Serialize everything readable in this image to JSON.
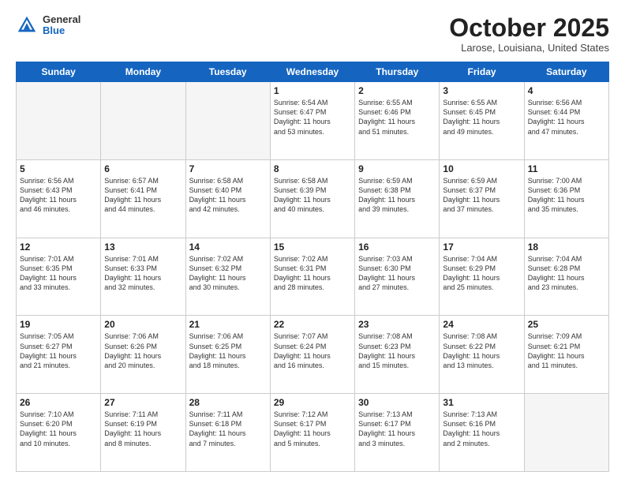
{
  "header": {
    "logo_general": "General",
    "logo_blue": "Blue",
    "month": "October 2025",
    "location": "Larose, Louisiana, United States"
  },
  "days_of_week": [
    "Sunday",
    "Monday",
    "Tuesday",
    "Wednesday",
    "Thursday",
    "Friday",
    "Saturday"
  ],
  "weeks": [
    [
      {
        "day": "",
        "info": ""
      },
      {
        "day": "",
        "info": ""
      },
      {
        "day": "",
        "info": ""
      },
      {
        "day": "1",
        "info": "Sunrise: 6:54 AM\nSunset: 6:47 PM\nDaylight: 11 hours\nand 53 minutes."
      },
      {
        "day": "2",
        "info": "Sunrise: 6:55 AM\nSunset: 6:46 PM\nDaylight: 11 hours\nand 51 minutes."
      },
      {
        "day": "3",
        "info": "Sunrise: 6:55 AM\nSunset: 6:45 PM\nDaylight: 11 hours\nand 49 minutes."
      },
      {
        "day": "4",
        "info": "Sunrise: 6:56 AM\nSunset: 6:44 PM\nDaylight: 11 hours\nand 47 minutes."
      }
    ],
    [
      {
        "day": "5",
        "info": "Sunrise: 6:56 AM\nSunset: 6:43 PM\nDaylight: 11 hours\nand 46 minutes."
      },
      {
        "day": "6",
        "info": "Sunrise: 6:57 AM\nSunset: 6:41 PM\nDaylight: 11 hours\nand 44 minutes."
      },
      {
        "day": "7",
        "info": "Sunrise: 6:58 AM\nSunset: 6:40 PM\nDaylight: 11 hours\nand 42 minutes."
      },
      {
        "day": "8",
        "info": "Sunrise: 6:58 AM\nSunset: 6:39 PM\nDaylight: 11 hours\nand 40 minutes."
      },
      {
        "day": "9",
        "info": "Sunrise: 6:59 AM\nSunset: 6:38 PM\nDaylight: 11 hours\nand 39 minutes."
      },
      {
        "day": "10",
        "info": "Sunrise: 6:59 AM\nSunset: 6:37 PM\nDaylight: 11 hours\nand 37 minutes."
      },
      {
        "day": "11",
        "info": "Sunrise: 7:00 AM\nSunset: 6:36 PM\nDaylight: 11 hours\nand 35 minutes."
      }
    ],
    [
      {
        "day": "12",
        "info": "Sunrise: 7:01 AM\nSunset: 6:35 PM\nDaylight: 11 hours\nand 33 minutes."
      },
      {
        "day": "13",
        "info": "Sunrise: 7:01 AM\nSunset: 6:33 PM\nDaylight: 11 hours\nand 32 minutes."
      },
      {
        "day": "14",
        "info": "Sunrise: 7:02 AM\nSunset: 6:32 PM\nDaylight: 11 hours\nand 30 minutes."
      },
      {
        "day": "15",
        "info": "Sunrise: 7:02 AM\nSunset: 6:31 PM\nDaylight: 11 hours\nand 28 minutes."
      },
      {
        "day": "16",
        "info": "Sunrise: 7:03 AM\nSunset: 6:30 PM\nDaylight: 11 hours\nand 27 minutes."
      },
      {
        "day": "17",
        "info": "Sunrise: 7:04 AM\nSunset: 6:29 PM\nDaylight: 11 hours\nand 25 minutes."
      },
      {
        "day": "18",
        "info": "Sunrise: 7:04 AM\nSunset: 6:28 PM\nDaylight: 11 hours\nand 23 minutes."
      }
    ],
    [
      {
        "day": "19",
        "info": "Sunrise: 7:05 AM\nSunset: 6:27 PM\nDaylight: 11 hours\nand 21 minutes."
      },
      {
        "day": "20",
        "info": "Sunrise: 7:06 AM\nSunset: 6:26 PM\nDaylight: 11 hours\nand 20 minutes."
      },
      {
        "day": "21",
        "info": "Sunrise: 7:06 AM\nSunset: 6:25 PM\nDaylight: 11 hours\nand 18 minutes."
      },
      {
        "day": "22",
        "info": "Sunrise: 7:07 AM\nSunset: 6:24 PM\nDaylight: 11 hours\nand 16 minutes."
      },
      {
        "day": "23",
        "info": "Sunrise: 7:08 AM\nSunset: 6:23 PM\nDaylight: 11 hours\nand 15 minutes."
      },
      {
        "day": "24",
        "info": "Sunrise: 7:08 AM\nSunset: 6:22 PM\nDaylight: 11 hours\nand 13 minutes."
      },
      {
        "day": "25",
        "info": "Sunrise: 7:09 AM\nSunset: 6:21 PM\nDaylight: 11 hours\nand 11 minutes."
      }
    ],
    [
      {
        "day": "26",
        "info": "Sunrise: 7:10 AM\nSunset: 6:20 PM\nDaylight: 11 hours\nand 10 minutes."
      },
      {
        "day": "27",
        "info": "Sunrise: 7:11 AM\nSunset: 6:19 PM\nDaylight: 11 hours\nand 8 minutes."
      },
      {
        "day": "28",
        "info": "Sunrise: 7:11 AM\nSunset: 6:18 PM\nDaylight: 11 hours\nand 7 minutes."
      },
      {
        "day": "29",
        "info": "Sunrise: 7:12 AM\nSunset: 6:17 PM\nDaylight: 11 hours\nand 5 minutes."
      },
      {
        "day": "30",
        "info": "Sunrise: 7:13 AM\nSunset: 6:17 PM\nDaylight: 11 hours\nand 3 minutes."
      },
      {
        "day": "31",
        "info": "Sunrise: 7:13 AM\nSunset: 6:16 PM\nDaylight: 11 hours\nand 2 minutes."
      },
      {
        "day": "",
        "info": ""
      }
    ]
  ]
}
